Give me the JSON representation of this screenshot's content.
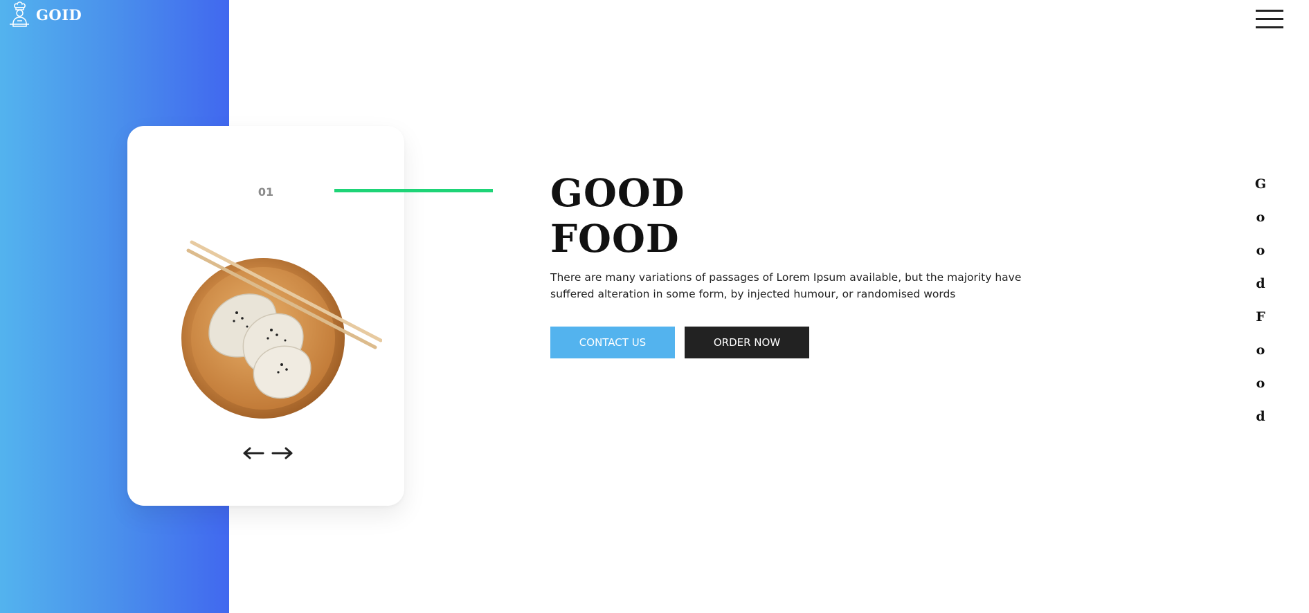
{
  "brand": {
    "name": "GOID",
    "logo_icon": "chef-icon"
  },
  "menu": {
    "icon": "hamburger-menu-icon"
  },
  "slider": {
    "current_number": "01",
    "image": "dumplings-bowl-image",
    "prev_icon": "arrow-left-icon",
    "next_icon": "arrow-right-icon"
  },
  "hero": {
    "title_line1": "GOOD",
    "title_line2": "FOOD",
    "description": "There are many variations of passages of Lorem Ipsum available, but the majority have suffered alteration in some form, by injected humour, or randomised words",
    "contact_label": "CONTACT US",
    "order_label": "ORDER NOW"
  },
  "side_text": [
    "G",
    "o",
    "o",
    "d",
    "F",
    "o",
    "o",
    "d"
  ],
  "colors": {
    "gradient_start": "#53b3ee",
    "gradient_end": "#4168ef",
    "accent_green": "#1ed477",
    "contact_button": "#53b3ee",
    "order_button": "#222222"
  }
}
